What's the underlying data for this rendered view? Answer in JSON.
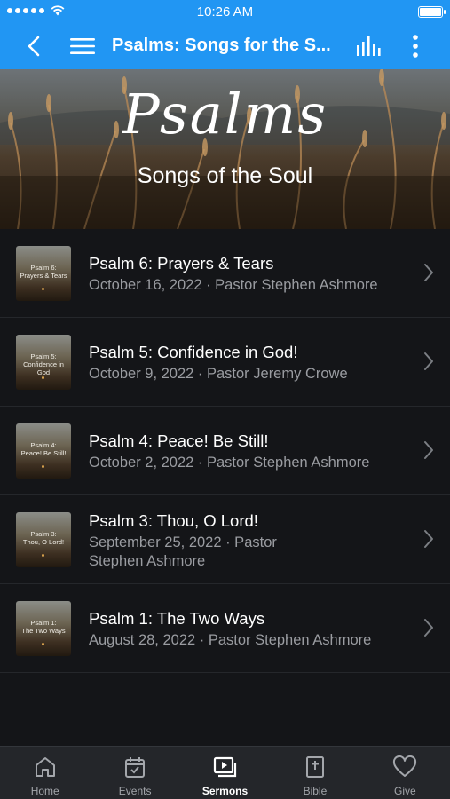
{
  "status_bar": {
    "time": "10:26 AM"
  },
  "nav": {
    "title": "Psalms: Songs for the S..."
  },
  "banner": {
    "title": "Psalms",
    "subtitle": "Songs of the Soul"
  },
  "sermons": [
    {
      "thumb_line1": "Psalm 6:",
      "thumb_line2": "Prayers & Tears",
      "title": "Psalm 6: Prayers & Tears",
      "meta": "October 16, 2022 · Pastor Stephen Ashmore"
    },
    {
      "thumb_line1": "Psalm 5:",
      "thumb_line2": "Confidence in God",
      "title": "Psalm 5: Confidence in God!",
      "meta": "October 9, 2022 · Pastor Jeremy Crowe"
    },
    {
      "thumb_line1": "Psalm 4:",
      "thumb_line2": "Peace! Be Still!",
      "title": "Psalm 4: Peace! Be Still!",
      "meta": "October 2, 2022 · Pastor Stephen Ashmore"
    },
    {
      "thumb_line1": "Psalm 3:",
      "thumb_line2": "Thou, O Lord!",
      "title": "Psalm 3: Thou, O Lord!",
      "meta": "September 25, 2022 · Pastor Stephen Ashmore"
    },
    {
      "thumb_line1": "Psalm 1:",
      "thumb_line2": "The Two Ways",
      "title": "Psalm 1: The Two Ways",
      "meta": "August 28, 2022 · Pastor Stephen Ashmore"
    }
  ],
  "tabs": [
    {
      "label": "Home",
      "icon": "home-icon"
    },
    {
      "label": "Events",
      "icon": "calendar-icon"
    },
    {
      "label": "Sermons",
      "icon": "play-video-icon",
      "active": true
    },
    {
      "label": "Bible",
      "icon": "bible-icon"
    },
    {
      "label": "Give",
      "icon": "heart-icon"
    }
  ],
  "colors": {
    "accent": "#2196f3",
    "background": "#141518",
    "tabbar": "#24262a",
    "secondary_text": "#9a9ca1"
  }
}
